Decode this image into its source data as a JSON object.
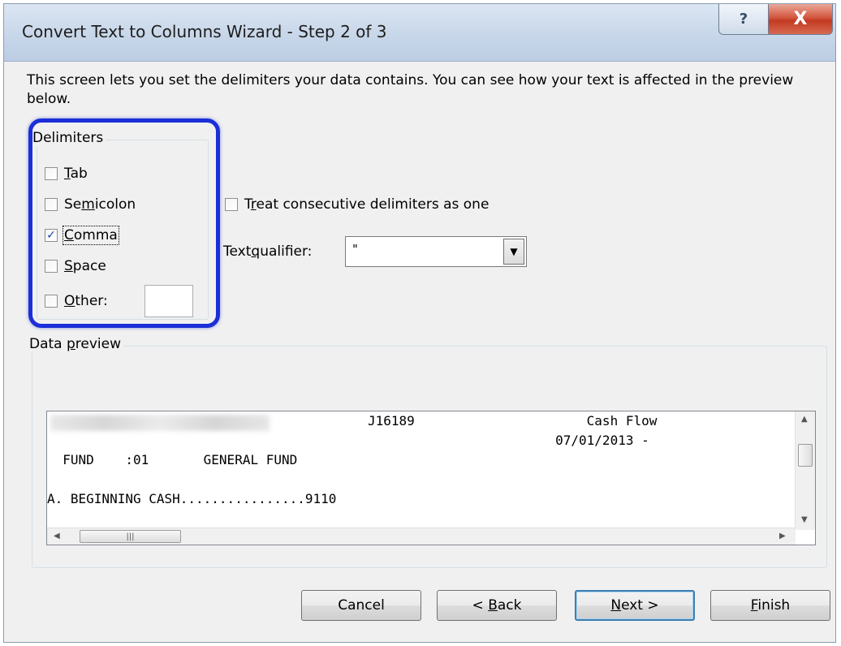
{
  "title": "Convert Text to Columns Wizard - Step 2 of 3",
  "title_buttons": {
    "help": "?",
    "close": "X"
  },
  "intro_text": "This screen lets you set the delimiters your data contains.  You can see how your text is affected in the preview below.",
  "delimiters": {
    "legend": "Delimiters",
    "options": [
      {
        "pre": "",
        "key": "T",
        "post": "ab",
        "checked": false
      },
      {
        "pre": "Se",
        "key": "m",
        "post": "icolon",
        "checked": false
      },
      {
        "pre": "",
        "key": "C",
        "post": "omma",
        "checked": true
      },
      {
        "pre": "",
        "key": "S",
        "post": "pace",
        "checked": false
      },
      {
        "pre": "",
        "key": "O",
        "post": "ther:",
        "checked": false
      }
    ],
    "other_value": ""
  },
  "consecutive": {
    "pre": "T",
    "key": "r",
    "post": "eat consecutive delimiters as one",
    "checked": false
  },
  "qualifier": {
    "pre": "Text ",
    "key": "q",
    "post": "ualifier:",
    "value": "\""
  },
  "preview": {
    "legend_pre": "Data ",
    "legend_key": "p",
    "legend_post": "review",
    "lines": [
      "                                         J16189                      Cash Flow",
      "                                                                 07/01/2013 -",
      "  FUND    :01       GENERAL FUND",
      "",
      "A. BEGINNING CASH................9110"
    ]
  },
  "buttons": {
    "cancel": "Cancel",
    "back_pre": "< ",
    "back_key": "B",
    "back_post": "ack",
    "next_key": "N",
    "next_post": "ext >",
    "finish_key": "F",
    "finish_post": "inish"
  }
}
